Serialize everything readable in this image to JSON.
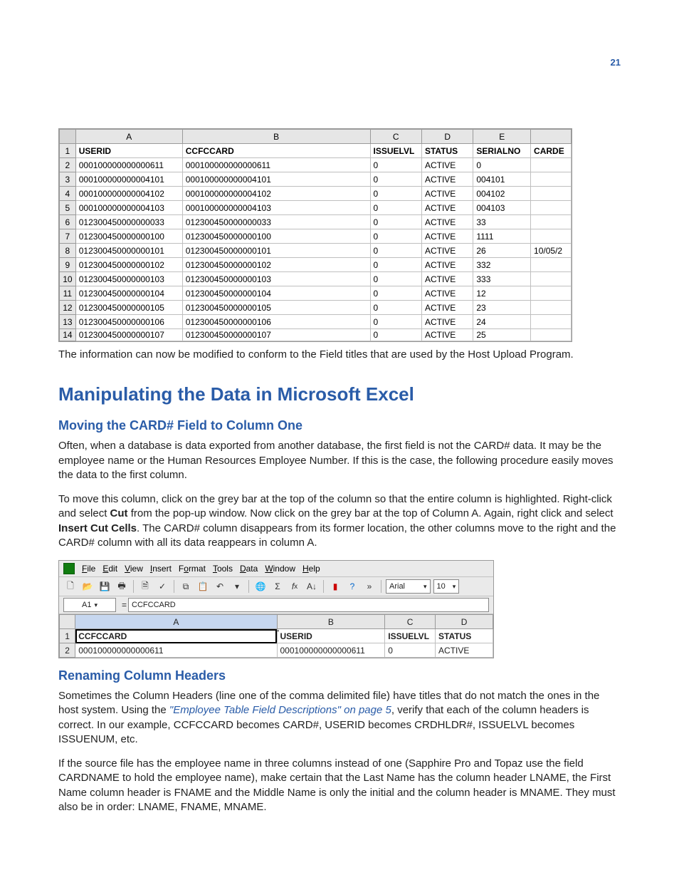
{
  "page_number": "21",
  "sheet1": {
    "col_letters": [
      "A",
      "B",
      "C",
      "D",
      "E",
      ""
    ],
    "headers": [
      "USERID",
      "CCFCCARD",
      "ISSUELVL",
      "STATUS",
      "SERIALNO",
      "CARDE"
    ],
    "rows": [
      {
        "n": "2",
        "A": "000100000000000611",
        "B": "000100000000000611",
        "C": "0",
        "D": "ACTIVE",
        "E": "0",
        "F": ""
      },
      {
        "n": "3",
        "A": "000100000000004101",
        "B": "000100000000004101",
        "C": "0",
        "D": "ACTIVE",
        "E": "004101",
        "F": ""
      },
      {
        "n": "4",
        "A": "000100000000004102",
        "B": "000100000000004102",
        "C": "0",
        "D": "ACTIVE",
        "E": "004102",
        "F": ""
      },
      {
        "n": "5",
        "A": "000100000000004103",
        "B": "000100000000004103",
        "C": "0",
        "D": "ACTIVE",
        "E": "004103",
        "F": ""
      },
      {
        "n": "6",
        "A": "012300450000000033",
        "B": "012300450000000033",
        "C": "0",
        "D": "ACTIVE",
        "E": "33",
        "F": ""
      },
      {
        "n": "7",
        "A": "012300450000000100",
        "B": "012300450000000100",
        "C": "0",
        "D": "ACTIVE",
        "E": "1111",
        "F": ""
      },
      {
        "n": "8",
        "A": "012300450000000101",
        "B": "012300450000000101",
        "C": "0",
        "D": "ACTIVE",
        "E": "26",
        "F": "10/05/2"
      },
      {
        "n": "9",
        "A": "012300450000000102",
        "B": "012300450000000102",
        "C": "0",
        "D": "ACTIVE",
        "E": "332",
        "F": ""
      },
      {
        "n": "10",
        "A": "012300450000000103",
        "B": "012300450000000103",
        "C": "0",
        "D": "ACTIVE",
        "E": "333",
        "F": ""
      },
      {
        "n": "11",
        "A": "012300450000000104",
        "B": "012300450000000104",
        "C": "0",
        "D": "ACTIVE",
        "E": "12",
        "F": ""
      },
      {
        "n": "12",
        "A": "012300450000000105",
        "B": "012300450000000105",
        "C": "0",
        "D": "ACTIVE",
        "E": "23",
        "F": ""
      },
      {
        "n": "13",
        "A": "012300450000000106",
        "B": "012300450000000106",
        "C": "0",
        "D": "ACTIVE",
        "E": "24",
        "F": ""
      }
    ],
    "partial_row": {
      "n": "14",
      "A": "012300450000000107",
      "B": "012300450000000107",
      "C": "0",
      "D": "ACTIVE",
      "E": "25",
      "F": ""
    }
  },
  "para_after_sheet1": "The information can now be modified to conform to the Field titles that are used by the Host Upload Program.",
  "h1": "Manipulating the Data in Microsoft Excel",
  "h2_move": "Moving the CARD# Field to Column One",
  "para_move_1": "Often, when a database is data exported from another database, the first field is not the CARD# data. It may be the employee name or the Human Resources Employee Number. If this is the case, the following procedure easily moves the data to the first column.",
  "para_move_2a": "To move this column, click on the grey bar at the top of the column so that the entire column is highlighted. Right-click and select ",
  "para_move_2b_bold": "Cut",
  "para_move_2c": " from the pop-up window. Now click on the grey bar at the top of Column A. Again, right click and select ",
  "para_move_2d_bold": "Insert Cut Cells",
  "para_move_2e": ". The CARD# column disappears from its former location, the other columns move to the right and the CARD# column with all its data reappears in column A.",
  "app": {
    "menus": [
      "File",
      "Edit",
      "View",
      "Insert",
      "Format",
      "Tools",
      "Data",
      "Window",
      "Help"
    ],
    "font_name": "Arial",
    "font_size": "10",
    "cell_ref": "A1",
    "formula_value": "CCFCCARD",
    "col_letters": [
      "A",
      "B",
      "C",
      "D"
    ],
    "header_row": [
      "CCFCCARD",
      "USERID",
      "ISSUELVL",
      "STATUS"
    ],
    "header_B_marker": "'",
    "data_row": {
      "n": "2",
      "A": "000100000000000611",
      "B": "000100000000000611",
      "C": "0",
      "D": "ACTIVE"
    }
  },
  "h2_rename": "Renaming Column Headers",
  "para_rename_1a": "Sometimes the Column Headers (line one of the comma delimited file) have titles that do not match the ones in the host system. Using the ",
  "para_rename_link": "\"Employee Table Field Descriptions\" on page 5",
  "para_rename_1b": ", verify that each of the column headers is correct. In our example, CCFCCARD becomes CARD#, USERID becomes CRDHLDR#, ISSUELVL becomes ISSUENUM, etc.",
  "para_rename_2": "If the source file has the employee name in three columns instead of one (Sapphire Pro and Topaz use the field CARDNAME to hold the employee name), make certain that the Last Name has the column header LNAME, the First Name column header is FNAME and the Middle Name is only the initial and the column header is MNAME. They must also be in order: LNAME, FNAME, MNAME."
}
